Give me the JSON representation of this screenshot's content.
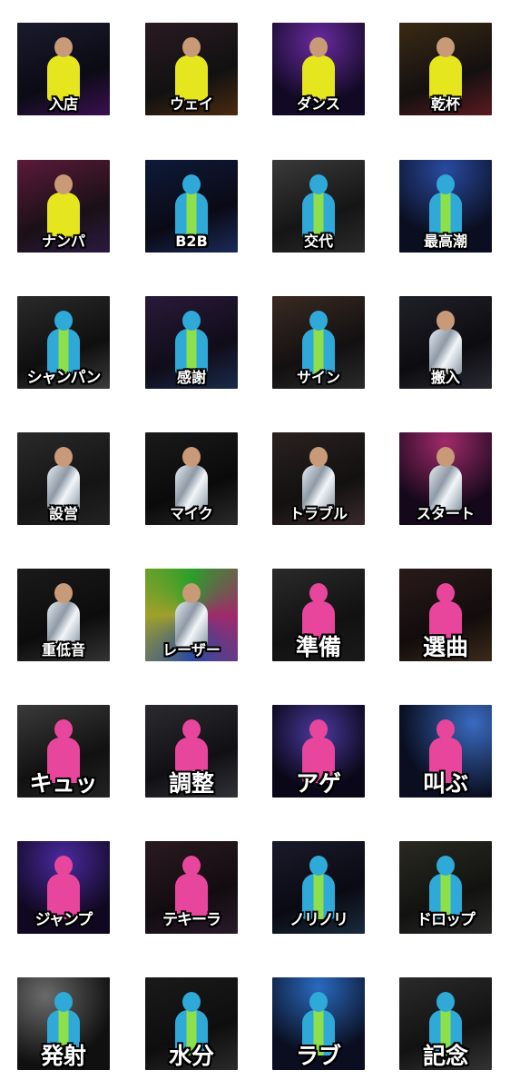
{
  "stickers": [
    {
      "caption": "入店",
      "suit": "yellow"
    },
    {
      "caption": "ウェイ",
      "suit": "yellow"
    },
    {
      "caption": "ダンス",
      "suit": "yellow"
    },
    {
      "caption": "乾杯",
      "suit": "yellow"
    },
    {
      "caption": "ナンパ",
      "suit": "yellow"
    },
    {
      "caption": "B2B",
      "suit": "blue-green"
    },
    {
      "caption": "交代",
      "suit": "blue-green"
    },
    {
      "caption": "最高潮",
      "suit": "blue-green"
    },
    {
      "caption": "シャンパン",
      "suit": "blue-green"
    },
    {
      "caption": "感謝",
      "suit": "blue-green"
    },
    {
      "caption": "サイン",
      "suit": "blue-green"
    },
    {
      "caption": "搬入",
      "suit": "silver"
    },
    {
      "caption": "設営",
      "suit": "silver"
    },
    {
      "caption": "マイク",
      "suit": "silver"
    },
    {
      "caption": "トラブル",
      "suit": "silver"
    },
    {
      "caption": "スタート",
      "suit": "silver"
    },
    {
      "caption": "重低音",
      "suit": "silver"
    },
    {
      "caption": "レーザー",
      "suit": "silver"
    },
    {
      "caption": "準備",
      "suit": "pink"
    },
    {
      "caption": "選曲",
      "suit": "pink"
    },
    {
      "caption": "キュッ",
      "suit": "pink"
    },
    {
      "caption": "調整",
      "suit": "pink"
    },
    {
      "caption": "アゲ",
      "suit": "pink"
    },
    {
      "caption": "叫ぶ",
      "suit": "pink"
    },
    {
      "caption": "ジャンプ",
      "suit": "pink"
    },
    {
      "caption": "テキーラ",
      "suit": "pink"
    },
    {
      "caption": "ノリノリ",
      "suit": "blue-green"
    },
    {
      "caption": "ドロップ",
      "suit": "blue-green"
    },
    {
      "caption": "発射",
      "suit": "blue-green"
    },
    {
      "caption": "水分",
      "suit": "blue-green"
    },
    {
      "caption": "ラブ",
      "suit": "blue-green"
    },
    {
      "caption": "記念",
      "suit": "blue-green"
    }
  ],
  "colors": {
    "yellow": "#e6e61f",
    "blue-green": "#2fa9d8",
    "blue-green-accent": "#8ee04a",
    "silver": "#b9c2cc",
    "pink": "#e8469c",
    "background": "#ffffff"
  }
}
